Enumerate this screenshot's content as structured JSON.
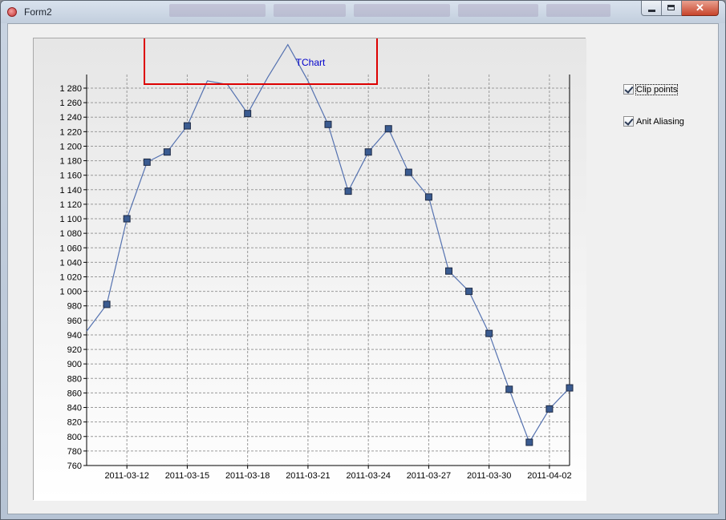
{
  "window": {
    "title": "Form2",
    "icon": "app-icon",
    "buttons": {
      "minimize": "minimize-icon",
      "maximize": "maximize-icon",
      "close": "close-icon"
    },
    "close_glyph": "✕"
  },
  "options": {
    "clip_points": {
      "label": "Clip points",
      "checked": true
    },
    "anti_aliasing": {
      "label": "Anit Aliasing",
      "checked": true
    }
  },
  "chart_data": {
    "type": "line",
    "title": "TChart",
    "ylim": [
      760,
      1280
    ],
    "yticks": [
      "1 280",
      "1 260",
      "1 240",
      "1 220",
      "1 200",
      "1 180",
      "1 160",
      "1 140",
      "1 120",
      "1 100",
      "1 080",
      "1 060",
      "1 040",
      "1 020",
      "1 000",
      "980",
      "960",
      "940",
      "920",
      "900",
      "880",
      "860",
      "840",
      "820",
      "800",
      "780",
      "760"
    ],
    "xticks": [
      "2011-03-12",
      "2011-03-15",
      "2011-03-18",
      "2011-03-21",
      "2011-03-24",
      "2011-03-27",
      "2011-03-30",
      "2011-04-02"
    ],
    "grid": true,
    "marker": "square",
    "colors": {
      "line": "#5572b0",
      "marker_fill": "#3a5b90",
      "marker_edge": "#1e2a44",
      "title": "#0000cc",
      "highlight_box": "#dd0000"
    },
    "x": [
      "2011-03-10",
      "2011-03-11",
      "2011-03-12",
      "2011-03-13",
      "2011-03-14",
      "2011-03-15",
      "2011-03-16",
      "2011-03-17",
      "2011-03-18",
      "2011-03-19",
      "2011-03-20",
      "2011-03-21",
      "2011-03-22",
      "2011-03-23",
      "2011-03-24",
      "2011-03-25",
      "2011-03-26",
      "2011-03-27",
      "2011-03-28",
      "2011-03-29",
      "2011-03-30",
      "2011-03-31",
      "2011-04-01",
      "2011-04-02",
      "2011-04-03"
    ],
    "y": [
      945,
      982,
      1100,
      1178,
      1192,
      1228,
      1290,
      1285,
      1245,
      1295,
      1340,
      1290,
      1230,
      1138,
      1192,
      1224,
      1164,
      1130,
      1028,
      1000,
      942,
      865,
      792,
      838,
      867
    ],
    "markers": [
      false,
      true,
      true,
      true,
      true,
      true,
      false,
      false,
      true,
      false,
      false,
      false,
      true,
      true,
      true,
      true,
      true,
      true,
      true,
      true,
      true,
      true,
      true,
      true,
      true
    ]
  }
}
